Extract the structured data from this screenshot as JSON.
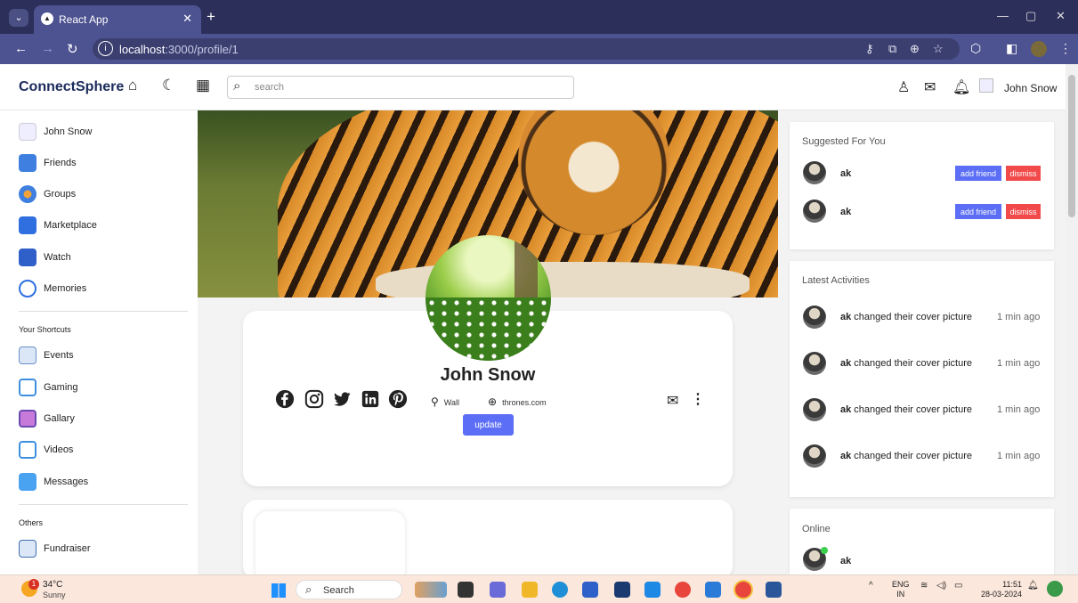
{
  "browser": {
    "tab_title": "React App",
    "url_host": "localhost",
    "url_path": ":3000/profile/1"
  },
  "navbar": {
    "logo": "ConnectSphere",
    "search_placeholder": "search",
    "username": "John Snow"
  },
  "sidebar": {
    "items": [
      {
        "label": "John Snow",
        "icon": "user-avatar-icon"
      },
      {
        "label": "Friends",
        "icon": "friends-icon"
      },
      {
        "label": "Groups",
        "icon": "groups-icon"
      },
      {
        "label": "Marketplace",
        "icon": "marketplace-icon"
      },
      {
        "label": "Watch",
        "icon": "watch-icon"
      },
      {
        "label": "Memories",
        "icon": "memories-icon"
      }
    ],
    "shortcuts_heading": "Your Shortcuts",
    "shortcuts": [
      {
        "label": "Events",
        "icon": "events-icon"
      },
      {
        "label": "Gaming",
        "icon": "gaming-icon"
      },
      {
        "label": "Gallary",
        "icon": "gallery-icon"
      },
      {
        "label": "Videos",
        "icon": "videos-icon"
      },
      {
        "label": "Messages",
        "icon": "messages-icon"
      }
    ],
    "others_heading": "Others",
    "others": [
      {
        "label": "Fundraiser",
        "icon": "fundraiser-icon"
      }
    ]
  },
  "profile": {
    "name": "John Snow",
    "location": "Wall",
    "website": "thrones.com",
    "update_label": "update"
  },
  "suggested": {
    "title": "Suggested For You",
    "users": [
      {
        "name": "ak",
        "add_label": "add friend",
        "dismiss_label": "dismiss"
      },
      {
        "name": "ak",
        "add_label": "add friend",
        "dismiss_label": "dismiss"
      }
    ]
  },
  "activities": {
    "title": "Latest Activities",
    "items": [
      {
        "user": "ak",
        "text": " changed their cover picture",
        "time": "1 min ago"
      },
      {
        "user": "ak",
        "text": " changed their cover picture",
        "time": "1 min ago"
      },
      {
        "user": "ak",
        "text": " changed their cover picture",
        "time": "1 min ago"
      },
      {
        "user": "ak",
        "text": " changed their cover picture",
        "time": "1 min ago"
      }
    ]
  },
  "online": {
    "title": "Online",
    "users": [
      {
        "name": "ak"
      }
    ]
  },
  "taskbar": {
    "temperature": "34°C",
    "condition": "Sunny",
    "weather_badge": "1",
    "search_label": "Search",
    "lang": "ENG",
    "region": "IN",
    "time": "11:51",
    "date": "28-03-2024"
  },
  "colors": {
    "accent": "#5b6ef5",
    "danger": "#f24a4a",
    "logo": "#1b2b5c",
    "browser_frame": "#2b2f5a"
  }
}
